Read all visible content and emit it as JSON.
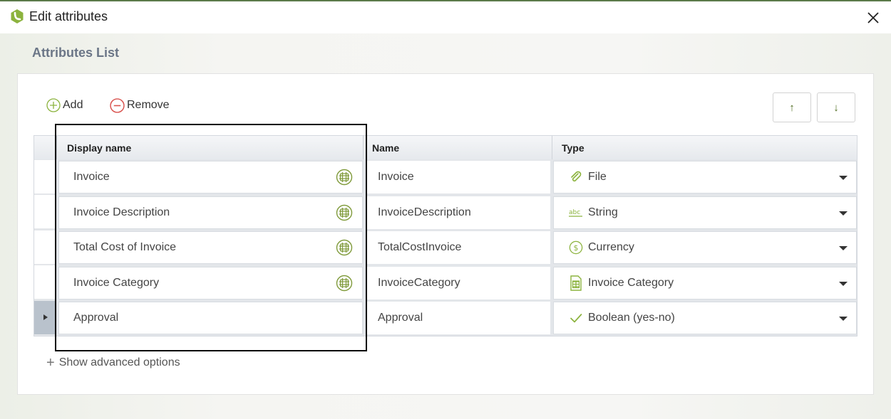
{
  "window": {
    "title": "Edit attributes",
    "close_icon": "close-icon"
  },
  "section": {
    "title": "Attributes List"
  },
  "toolbar": {
    "add_label": "Add",
    "remove_label": "Remove",
    "move_up_symbol": "↑",
    "move_down_symbol": "↓"
  },
  "table": {
    "columns": [
      "Display name",
      "Name",
      "Type"
    ],
    "rows": [
      {
        "display_name": "Invoice",
        "name": "Invoice",
        "type": "File",
        "type_icon": "paperclip-icon",
        "has_multilang_icon": true
      },
      {
        "display_name": "Invoice Description",
        "name": "InvoiceDescription",
        "type": "String",
        "type_icon": "abc-icon",
        "has_multilang_icon": true
      },
      {
        "display_name": "Total Cost of Invoice",
        "name": "TotalCostInvoice",
        "type": "Currency",
        "type_icon": "dollar-icon",
        "has_multilang_icon": true
      },
      {
        "display_name": "Invoice Category",
        "name": "InvoiceCategory",
        "type": "Invoice Category",
        "type_icon": "entity-table-icon",
        "has_multilang_icon": true
      },
      {
        "display_name": "Approval",
        "name": "Approval",
        "type": "Boolean (yes-no)",
        "type_icon": "checkmark-icon",
        "has_multilang_icon": false,
        "selected": true
      }
    ]
  },
  "advanced": {
    "label": "Show advanced options"
  },
  "colors": {
    "accent_green": "#8cb33e",
    "remove_red": "#d9534f",
    "title_gray": "#6b7687"
  }
}
